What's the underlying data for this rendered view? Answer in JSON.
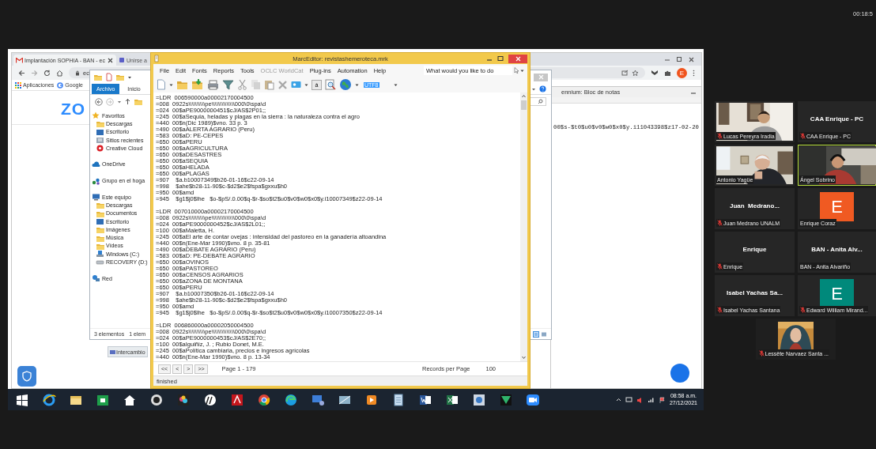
{
  "meeting": {
    "timer": "00:18:5"
  },
  "browser": {
    "tabs": [
      {
        "label": "Implantación SOPHIA - BAN - ec",
        "selected": true,
        "closable": true
      },
      {
        "label": "Unirse a",
        "selected": false,
        "closable": false
      }
    ],
    "address": "ec",
    "bookmarks": [
      "Aplicaciones",
      "Google"
    ],
    "logo": "ZO",
    "profile": "E"
  },
  "notepad": {
    "title": "ennium: Bloc de notas",
    "lines": [
      "00$s-$t0$u0$v0$w0$x0$y.i11043398$z17-02-20"
    ]
  },
  "explorer": {
    "ribbon_tabs": [
      {
        "label": "Archivo",
        "selected": true
      },
      {
        "label": "Inicio",
        "selected": false
      }
    ],
    "nav": [
      {
        "label": "Favoritos",
        "kind": "star",
        "children": [
          {
            "label": "Descargas",
            "kind": "folder"
          },
          {
            "label": "Escritorio",
            "kind": "desktop"
          },
          {
            "label": "Sitios recientes",
            "kind": "recent"
          },
          {
            "label": "Creative Cloud",
            "kind": "creative"
          }
        ]
      },
      {
        "label": "OneDrive",
        "kind": "onedrive"
      },
      {
        "label": "Grupo en el hoga",
        "kind": "homegroup"
      },
      {
        "label": "Este equipo",
        "kind": "pc",
        "children": [
          {
            "label": "Descargas",
            "kind": "folder"
          },
          {
            "label": "Documentos",
            "kind": "folder"
          },
          {
            "label": "Escritorio",
            "kind": "desktop"
          },
          {
            "label": "Imágenes",
            "kind": "folder"
          },
          {
            "label": "Música",
            "kind": "folder"
          },
          {
            "label": "Vídeos",
            "kind": "folder"
          },
          {
            "label": "Windows (C:)",
            "kind": "drive"
          },
          {
            "label": "RECOVERY (D:)",
            "kind": "disk"
          }
        ]
      },
      {
        "label": "Red",
        "kind": "network"
      }
    ],
    "status": [
      "3 elementos",
      "1 elem"
    ]
  },
  "desktop": {
    "shortcut": "Intercambio"
  },
  "marc_editor": {
    "title": "MarcEditor: revistashemeroteca.mrk",
    "menu": [
      {
        "label": "File",
        "disabled": false
      },
      {
        "label": "Edit",
        "disabled": false
      },
      {
        "label": "Fonts",
        "disabled": false
      },
      {
        "label": "Reports",
        "disabled": false
      },
      {
        "label": "Tools",
        "disabled": false
      },
      {
        "label": "OCLC WorldCat",
        "disabled": true
      },
      {
        "label": "Plug-ins",
        "disabled": false
      },
      {
        "label": "Automation",
        "disabled": false
      },
      {
        "label": "Help",
        "disabled": false
      }
    ],
    "search_placeholder": "What would you like to do",
    "char_button": "á",
    "encoding": "UTF8",
    "records": [
      [
        "=LDR  006590000a00002170004500",
        "=008  0922s\\\\\\\\\\\\\\\\\\\\pe\\\\\\\\\\\\\\\\\\\\\\\\\\\\000\\0\\spa\\d",
        "=024  00$aPE9000000451$cJ/AS$2P01;;",
        "=245  00$aSequia, heladas y plagas en la sierra : la naturaleza contra el agro",
        "=440  00$n(Dic 1989)$vno. 33 p. 3",
        "=490  00$aALERTA AGRARIO (Peru)",
        "=583  00$aD: PE-CEPES",
        "=650  00$aPERU",
        "=650  00$aAGRICULTURA",
        "=650  00$aDESASTRES",
        "=650  00$aSEQUIA",
        "=650  00$aHELADA",
        "=650  00$aPLAGAS",
        "=907    $a.b10007349$b26-01-16$c22-09-14",
        "=998    $ahe$b28-11-90$c-$d2$e2$fspa$gxxu$h0",
        "=950  00$amd",
        "=945    $g1$j0$lhe   $o-$pS/.0.00$q-$r-$so$t2$u0$v0$w0$x0$y.i10007349$z22-09-14"
      ],
      [
        "=LDR  007010000a00002170004500",
        "=008  0922s\\\\\\\\\\\\\\\\\\\\pe\\\\\\\\\\\\\\\\\\\\\\\\\\\\000\\0\\spa\\d",
        "=024  00$aPE9000000452$cJ/AS$2L01;;",
        "=100  00$aMaletta, H.",
        "=245  00$aEl arte de contar ovejas : intensidad del pastoreo en la ganadería altoandina",
        "=440  00$n(Ene-Mar 1990)$vno. 8 p. 35-81",
        "=490  00$aDEBATE AGRARIO (Peru)",
        "=583  00$aD: PE-DEBATE AGRARIO",
        "=650  00$aOVINOS",
        "=650  00$aPASTOREO",
        "=650  00$aCENSOS AGRARIOS",
        "=650  00$aZONA DE MONTANA",
        "=650  00$aPERU",
        "=907    $a.b10007350$b26-01-16$c22-09-14",
        "=998    $ahe$b28-11-90$c-$d2$e2$fspa$gxxu$h0",
        "=950  00$amd",
        "=945    $g1$j0$lhe   $o-$pS/.0.00$q-$r-$so$t2$u0$v0$w0$x0$y.i10007350$z22-09-14"
      ],
      [
        "=LDR  006860000a00002050004500",
        "=008  0922s\\\\\\\\\\\\\\\\\\\\pe\\\\\\\\\\\\\\\\\\\\\\\\\\\\000\\0\\spa\\d",
        "=024  00$aPE9000000453$cJ/AS$2E70;;",
        "=100  00$aIguiñiz, J. ; Rubio Donet, M.E.",
        "=245  00$aPolítica cambiaria, precios e ingresos agrícolas",
        "=440  00$n(Ene-Mar 1990)$vno. 8 p. 13-34"
      ]
    ],
    "pager": {
      "buttons": [
        "<<",
        "<",
        ">",
        ">>"
      ],
      "page": "Page 1 - 179",
      "per_page_label": "Records per Page",
      "per_page": "100"
    },
    "status": "finished"
  },
  "taskbar": {
    "time": "08:58 a.m.",
    "date": "27/12/2021"
  },
  "participants": [
    {
      "kind": "video",
      "name": "Lucas Pereyra Iradia",
      "muted": true,
      "speaking": false
    },
    {
      "kind": "name",
      "title": "CAA Enrique - PC",
      "name": "CAA Enrique - PC",
      "muted": true,
      "speaking": false
    },
    {
      "kind": "video",
      "name": "Antonio Yagüe",
      "muted": false,
      "speaking": false
    },
    {
      "kind": "video",
      "name": "Ángel Sobrino",
      "muted": false,
      "speaking": true
    },
    {
      "kind": "name",
      "title": "Juan  Medrano...",
      "name": "Juan Medrano UNALM",
      "muted": true,
      "speaking": false
    },
    {
      "kind": "avatar",
      "letter": "E",
      "color": "#f05a22",
      "name": "Enrique Coraz",
      "muted": false,
      "speaking": false
    },
    {
      "kind": "name",
      "title": "Enrique",
      "name": "Enrique",
      "muted": true,
      "speaking": false
    },
    {
      "kind": "name",
      "title": "BAN - Anita Alv...",
      "name": "BAN - Anita Alvariño",
      "muted": false,
      "speaking": false
    },
    {
      "kind": "name",
      "title": "Isabel Yachas Sa...",
      "name": "Isabel Yachas Santana",
      "muted": true,
      "speaking": false
    },
    {
      "kind": "avatar",
      "letter": "E",
      "color": "#00897b",
      "name": "Edward William Mirand...",
      "muted": true,
      "speaking": false
    },
    {
      "name": "Lessête Narvaez Santa ...",
      "muted": true,
      "speaking": false
    }
  ]
}
